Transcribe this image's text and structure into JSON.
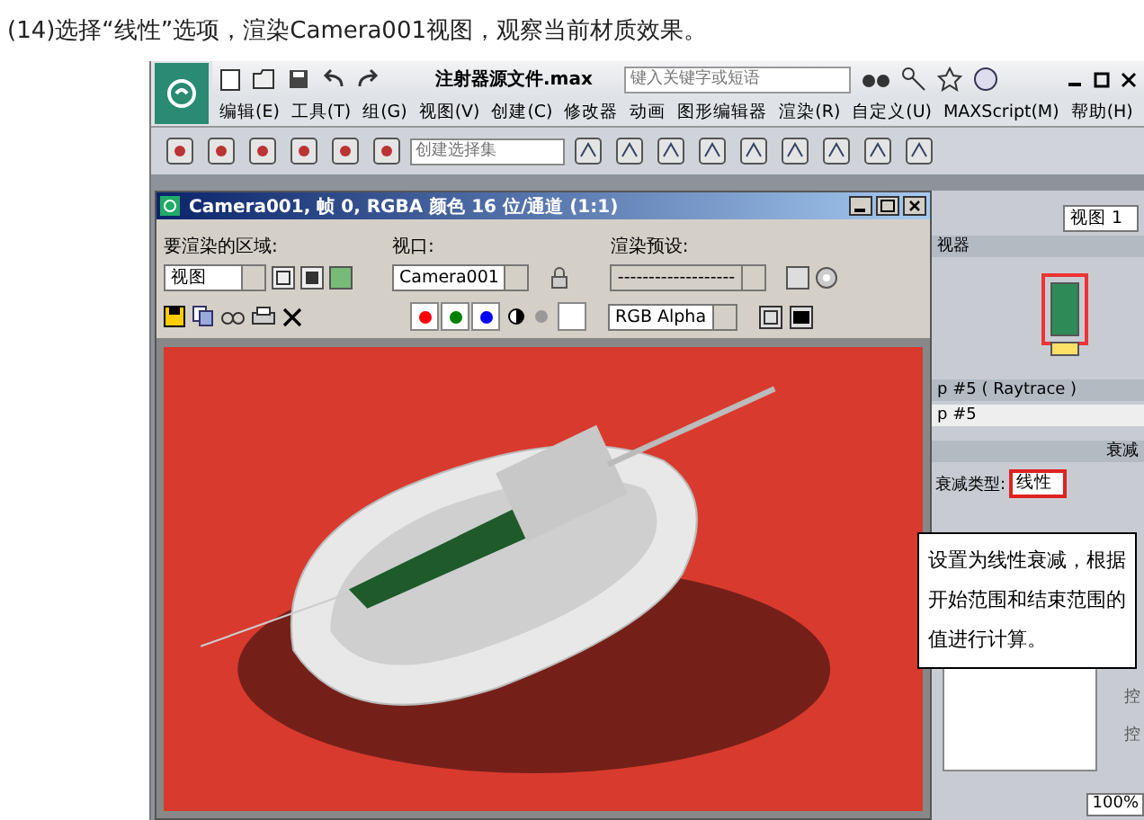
{
  "caption": "(14)选择“线性”选项，渲染Camera001视图，观察当前材质效果。",
  "app": {
    "title": "注射器源文件.max",
    "search": {
      "placeholder": "键入关键字或短语"
    },
    "menu": [
      "编辑(E)",
      "工具(T)",
      "组(G)",
      "视图(V)",
      "创建(C)",
      "修改器",
      "动画",
      "图形编辑器",
      "渲染(R)",
      "自定义(U)",
      "MAXScript(M)",
      "帮助(H)"
    ],
    "selection_set": {
      "placeholder": "创建选择集"
    }
  },
  "render_window": {
    "title": "Camera001, 帧 0, RGBA 颜色 16 位/通道 (1:1)",
    "area": {
      "label": "要渲染的区域:",
      "value": "视图"
    },
    "viewport": {
      "label": "视口:",
      "value": "Camera001"
    },
    "preset": {
      "label": "渲染预设:",
      "value": "-------------------"
    },
    "channels": [
      {
        "color": "#ff0000"
      },
      {
        "color": "#008000"
      },
      {
        "color": "#0000ff"
      }
    ],
    "display_channel": "RGB Alpha"
  },
  "side_panel": {
    "view_field": "视图 1",
    "header": "视器",
    "swatches": [
      {
        "color": "#2e8b57",
        "highlighted": true
      },
      {
        "color": "#ffe066",
        "highlighted": false
      }
    ],
    "material_header": "p #5 ( Raytrace )",
    "material_name": "p #5",
    "falloff_header": "衰减",
    "falloff_type": {
      "label": "衰减类型:",
      "value": "线性",
      "highlighted": true
    },
    "cut_labels": [
      "控",
      "控"
    ],
    "zoom": "100%"
  },
  "callout": "设置为线性衰减，根据开始范围和结束范围的值进行计算。"
}
